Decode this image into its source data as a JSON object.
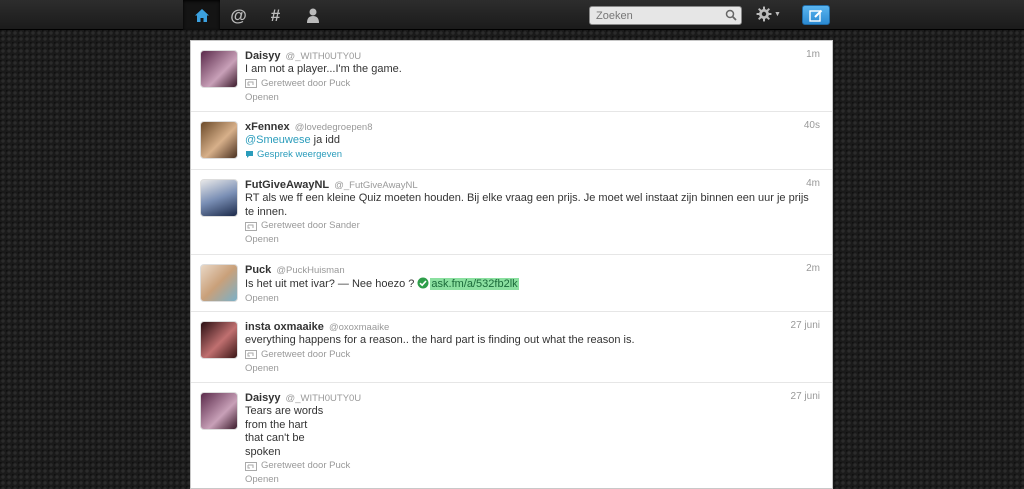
{
  "nav": {
    "items": [
      {
        "name": "home",
        "active": true
      },
      {
        "name": "connect",
        "glyph": "@"
      },
      {
        "name": "discover",
        "glyph": "#"
      },
      {
        "name": "me"
      }
    ]
  },
  "search": {
    "placeholder": "Zoeken"
  },
  "colors": {
    "accent": "#3ba1e0",
    "link": "#2a9cbb",
    "highlight": "#8be0a0"
  },
  "tweets": [
    {
      "fullname": "Daisyy",
      "username": "@_WITH0UTY0U",
      "time": "1m",
      "text": "I am not a player...I'm the game.",
      "retweeted_by": "Geretweet door Puck",
      "open": "Openen"
    },
    {
      "fullname": "xFennex",
      "username": "@lovedegroepen8",
      "time": "40s",
      "mention": "@Smeuwese",
      "text": " ja idd",
      "conversation": "Gesprek weergeven"
    },
    {
      "fullname": "FutGiveAwayNL",
      "username": "@_FutGiveAwayNL",
      "time": "4m",
      "text": "RT als we ff een kleine Quiz moeten houden. Bij elke vraag een prijs. Je moet wel instaat zijn binnen een uur je prijs te innen.",
      "retweeted_by": "Geretweet door Sander",
      "open": "Openen"
    },
    {
      "fullname": "Puck",
      "username": "@PuckHuisman",
      "time": "2m",
      "text": "Is het uit met ivar? — Nee hoezo ? ",
      "link": "ask.fm/a/532fb2lk",
      "open": "Openen"
    },
    {
      "fullname": "insta oxmaaike",
      "username": "@oxoxmaaike",
      "time": "27 juni",
      "text": "everything happens for a reason.. the hard part is finding out what the reason is.",
      "retweeted_by": "Geretweet door Puck",
      "open": "Openen"
    },
    {
      "fullname": "Daisyy",
      "username": "@_WITH0UTY0U",
      "time": "27 juni",
      "text": "Tears are words\nfrom the hart\nthat can't be\nspoken",
      "retweeted_by": "Geretweet door Puck",
      "open": "Openen"
    }
  ]
}
